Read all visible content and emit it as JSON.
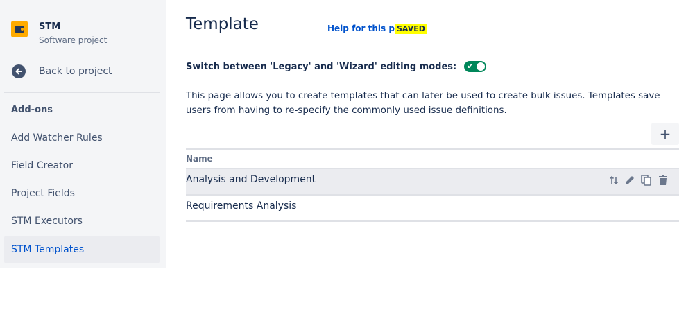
{
  "sidebar": {
    "project_name": "STM",
    "project_type": "Software project",
    "back_label": "Back to project",
    "section_title": "Add-ons",
    "items": [
      {
        "label": "Add Watcher Rules"
      },
      {
        "label": "Field Creator"
      },
      {
        "label": "Project Fields"
      },
      {
        "label": "STM Executors"
      },
      {
        "label": "STM Templates",
        "active": true
      }
    ]
  },
  "main": {
    "title": "Template",
    "help_link": "Help for this page",
    "saved_badge": "SAVED",
    "switch_label": "Switch between 'Legacy' and 'Wizard' editing modes:",
    "switch_on": true,
    "description": "This page allows you to create templates that can later be used to create bulk issues. Templates save users from having to re-specify the commonly used issue definitions.",
    "add_button": "+",
    "table": {
      "columns": [
        "Name"
      ],
      "rows": [
        {
          "name": "Analysis and Development"
        },
        {
          "name": "Requirements Analysis"
        }
      ]
    }
  },
  "icons": {
    "project": "project-icon",
    "back": "arrow-left-icon",
    "reorder": "sort-icon",
    "edit": "pencil-icon",
    "copy": "copy-icon",
    "delete": "trash-icon"
  },
  "colors": {
    "accent": "#0052cc",
    "toggle_on": "#00875a",
    "saved_highlight": "#ffff00"
  }
}
